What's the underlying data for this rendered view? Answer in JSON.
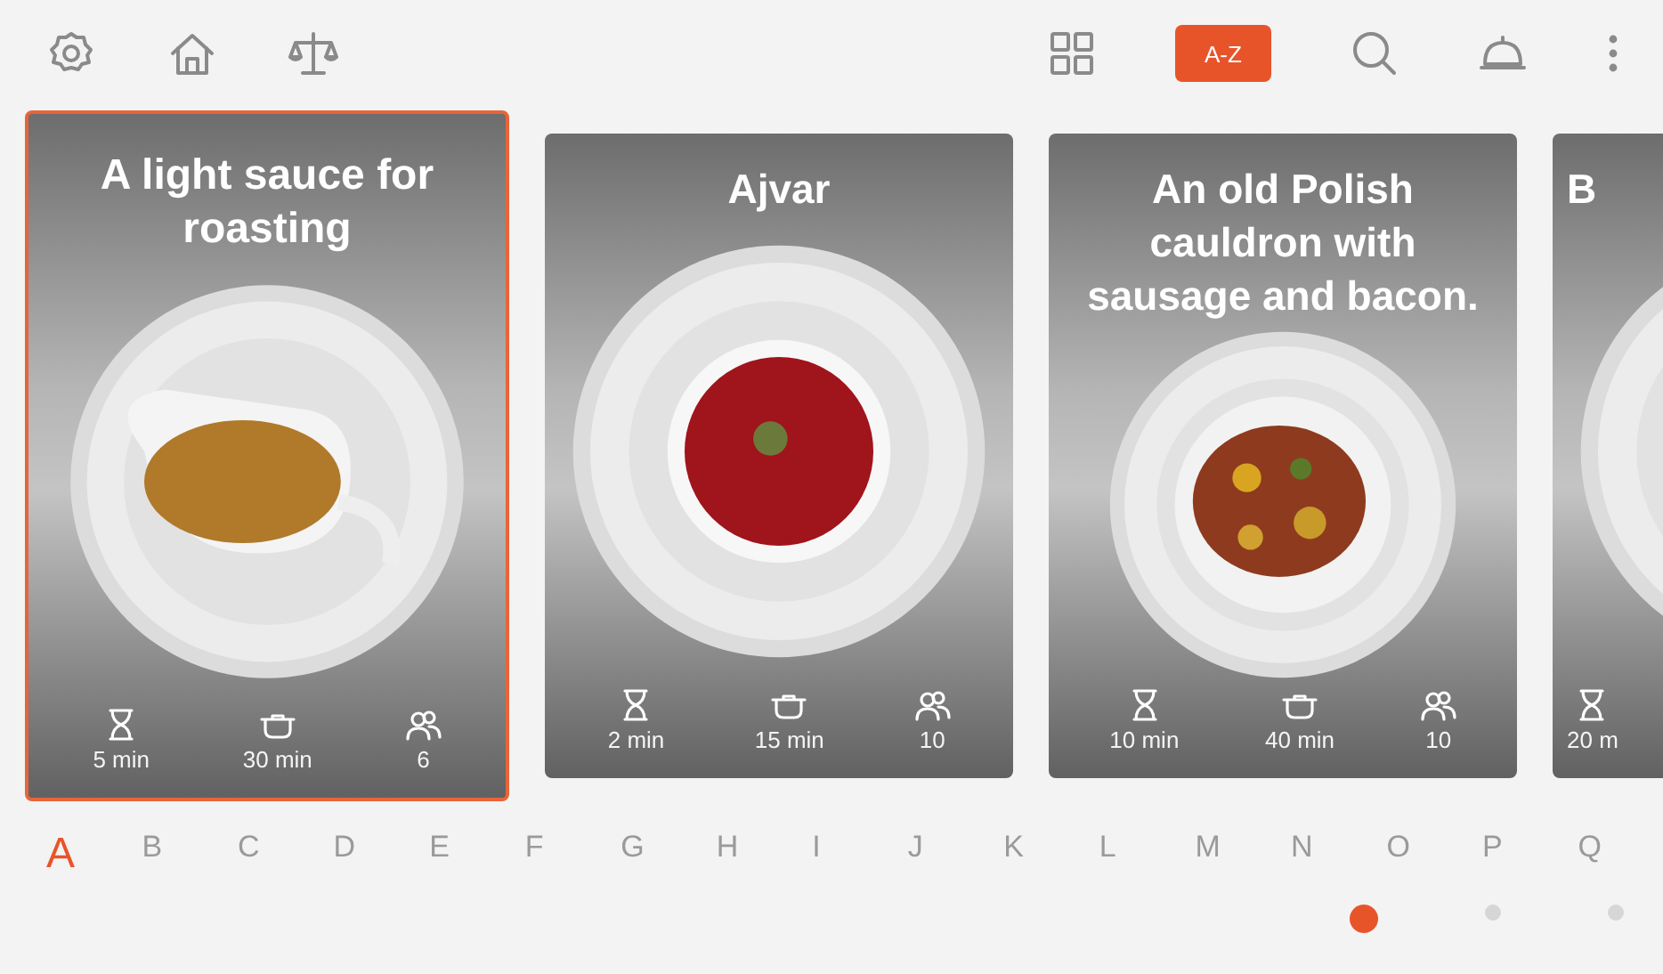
{
  "toolbar": {
    "sort_button": {
      "label": "A-Z",
      "selected": true
    }
  },
  "recipes": [
    {
      "title": "A light sauce for roasting",
      "selected": true,
      "cut": false,
      "stats": [
        {
          "kind": "time",
          "text": "5 min"
        },
        {
          "kind": "cook",
          "text": "30 min"
        },
        {
          "kind": "servings",
          "text": "6"
        }
      ]
    },
    {
      "title": "Ajvar",
      "selected": false,
      "cut": false,
      "stats": [
        {
          "kind": "time",
          "text": "2 min"
        },
        {
          "kind": "cook",
          "text": "15 min"
        },
        {
          "kind": "servings",
          "text": "10"
        }
      ]
    },
    {
      "title": "An old Polish cauldron with sausage and bacon.",
      "selected": false,
      "cut": false,
      "stats": [
        {
          "kind": "time",
          "text": "10 min"
        },
        {
          "kind": "cook",
          "text": "40 min"
        },
        {
          "kind": "servings",
          "text": "10"
        }
      ]
    },
    {
      "title": "B",
      "selected": false,
      "cut": true,
      "stats": [
        {
          "kind": "time",
          "text": "20 m"
        }
      ]
    }
  ],
  "alphabet": [
    {
      "letter": "A",
      "selected": true
    },
    {
      "letter": "B",
      "selected": false
    },
    {
      "letter": "C",
      "selected": false
    },
    {
      "letter": "D",
      "selected": false
    },
    {
      "letter": "E",
      "selected": false
    },
    {
      "letter": "F",
      "selected": false
    },
    {
      "letter": "G",
      "selected": false
    },
    {
      "letter": "H",
      "selected": false
    },
    {
      "letter": "I",
      "selected": false
    },
    {
      "letter": "J",
      "selected": false
    },
    {
      "letter": "K",
      "selected": false
    },
    {
      "letter": "L",
      "selected": false
    },
    {
      "letter": "M",
      "selected": false
    },
    {
      "letter": "N",
      "selected": false
    },
    {
      "letter": "O",
      "selected": false
    },
    {
      "letter": "P",
      "selected": false
    },
    {
      "letter": "Q",
      "selected": false
    }
  ],
  "pages": [
    {
      "selected": true
    },
    {
      "selected": false
    },
    {
      "selected": false
    }
  ]
}
